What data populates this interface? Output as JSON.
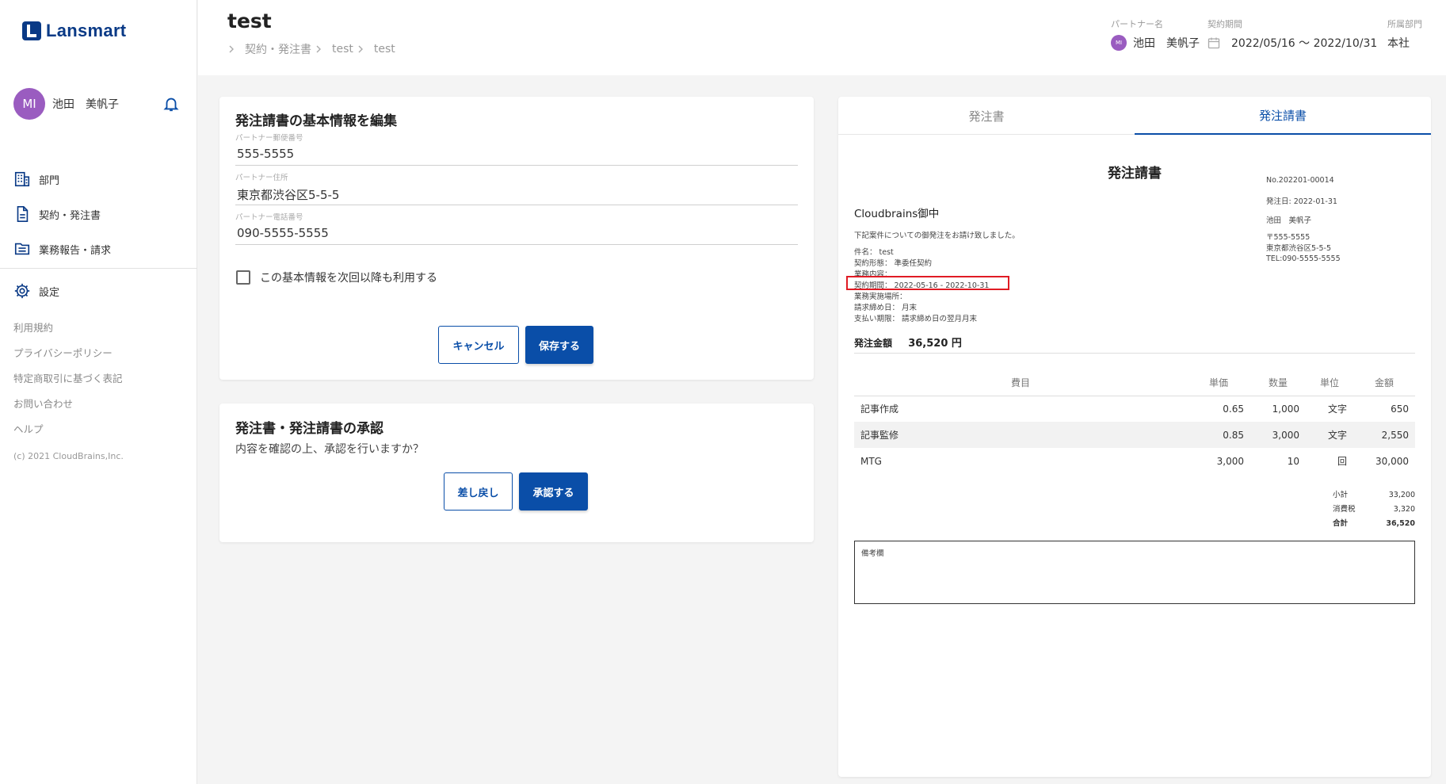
{
  "app": {
    "logo_text": "Lansmart",
    "brand_color": "#0a3a86",
    "accent_color": "#0a4ea8",
    "highlight_color": "#e01b24"
  },
  "user": {
    "initials": "MI",
    "name": "池田　美帆子"
  },
  "nav": [
    {
      "icon": "building-icon",
      "label": "部門"
    },
    {
      "icon": "document-icon",
      "label": "契約・発注書"
    },
    {
      "icon": "folder-icon",
      "label": "業務報告・請求"
    }
  ],
  "settings_label": "設定",
  "links": [
    "利用規約",
    "プライバシーポリシー",
    "特定商取引に基づく表記",
    "お問い合わせ",
    "ヘルプ"
  ],
  "copyright": "(c) 2021 CloudBrains,Inc.",
  "header": {
    "title": "test",
    "breadcrumb": [
      "契約・発注書",
      "test",
      "test"
    ],
    "partner_label": "パートナー名",
    "partner_initials": "MI",
    "partner_name": "池田　美帆子",
    "period_label": "契約期間",
    "period_value": "2022/05/16 〜 2022/10/31",
    "dept_label": "所属部門",
    "dept_value": "本社"
  },
  "edit_card": {
    "title": "発注請書の基本情報を編集",
    "fields": [
      {
        "label": "パートナー郵便番号",
        "value": "555-5555"
      },
      {
        "label": "パートナー住所",
        "value": "東京都渋谷区5-5-5"
      },
      {
        "label": "パートナー電話番号",
        "value": "090-5555-5555"
      }
    ],
    "checkbox_label": "この基本情報を次回以降も利用する",
    "cancel_label": "キャンセル",
    "save_label": "保存する"
  },
  "approve_card": {
    "title": "発注書・発注請書の承認",
    "text": "内容を確認の上、承認を行いますか？",
    "reject_label": "差し戻し",
    "approve_label": "承認する"
  },
  "preview": {
    "tabs": [
      {
        "label": "発注書"
      },
      {
        "label": "発注請書"
      }
    ],
    "active_tab": 1,
    "doc_title": "発注請書",
    "to": "Cloudbrains御中",
    "intro": "下記案件についての御発注をお請け致しました。",
    "meta_left": [
      "件名： test",
      "契約形態： 準委任契約",
      "業務内容：",
      "契約期間： 2022-05-16 - 2022-10-31",
      "業務実施場所：",
      "請求締め日： 月末",
      "支払い期限： 請求締め日の翌月月末"
    ],
    "doc_no": "No.202201-00014",
    "order_date": "発注日: 2022-01-31",
    "person": "池田　美帆子",
    "postal": "〒555-5555",
    "address": "東京都渋谷区5-5-5",
    "tel": "TEL:090-5555-5555",
    "amount_label": "発注金額",
    "amount_value": "36,520 円",
    "table": {
      "headers": [
        "費目",
        "単価",
        "数量",
        "単位",
        "金額"
      ],
      "rows": [
        [
          "記事作成",
          "0.65",
          "1,000",
          "文字",
          "650"
        ],
        [
          "記事監修",
          "0.85",
          "3,000",
          "文字",
          "2,550"
        ],
        [
          "MTG",
          "3,000",
          "10",
          "回",
          "30,000"
        ]
      ]
    },
    "totals": [
      {
        "label": "小計",
        "value": "33,200"
      },
      {
        "label": "消費税",
        "value": "3,320"
      },
      {
        "label": "合計",
        "value": "36,520"
      }
    ],
    "notes_label": "備考欄"
  }
}
